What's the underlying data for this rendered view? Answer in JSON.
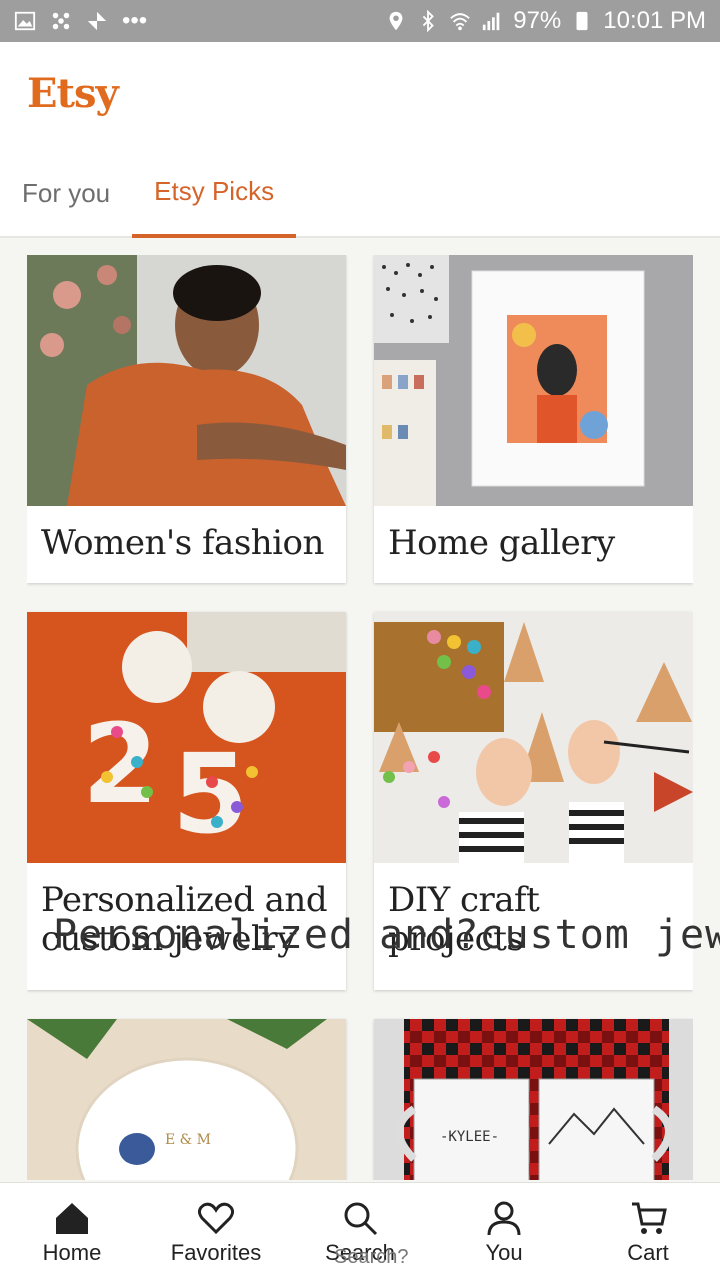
{
  "status_bar": {
    "battery": "97%",
    "time": "10:01 PM"
  },
  "header": {
    "logo": "Etsy"
  },
  "tabs": [
    {
      "label": "For you",
      "active": false
    },
    {
      "label": "Etsy Picks",
      "active": true
    }
  ],
  "cards": [
    {
      "caption": "Women's fashion"
    },
    {
      "caption": "Home gallery"
    },
    {
      "caption": "Personalized and custom jewelry"
    },
    {
      "caption": "DIY craft projects"
    }
  ],
  "overlay_text": "Personalized and?custom jew",
  "bottom_nav": [
    {
      "label": "Home",
      "icon": "home-icon"
    },
    {
      "label": "Favorites",
      "icon": "heart-icon"
    },
    {
      "label": "Search",
      "icon": "search-icon"
    },
    {
      "label": "You",
      "icon": "person-icon"
    },
    {
      "label": "Cart",
      "icon": "cart-icon"
    }
  ],
  "ghost_search": "Search?",
  "colors": {
    "accent": "#d5642a",
    "logo": "#e06b1f",
    "status_bar": "#9e9e9e"
  }
}
